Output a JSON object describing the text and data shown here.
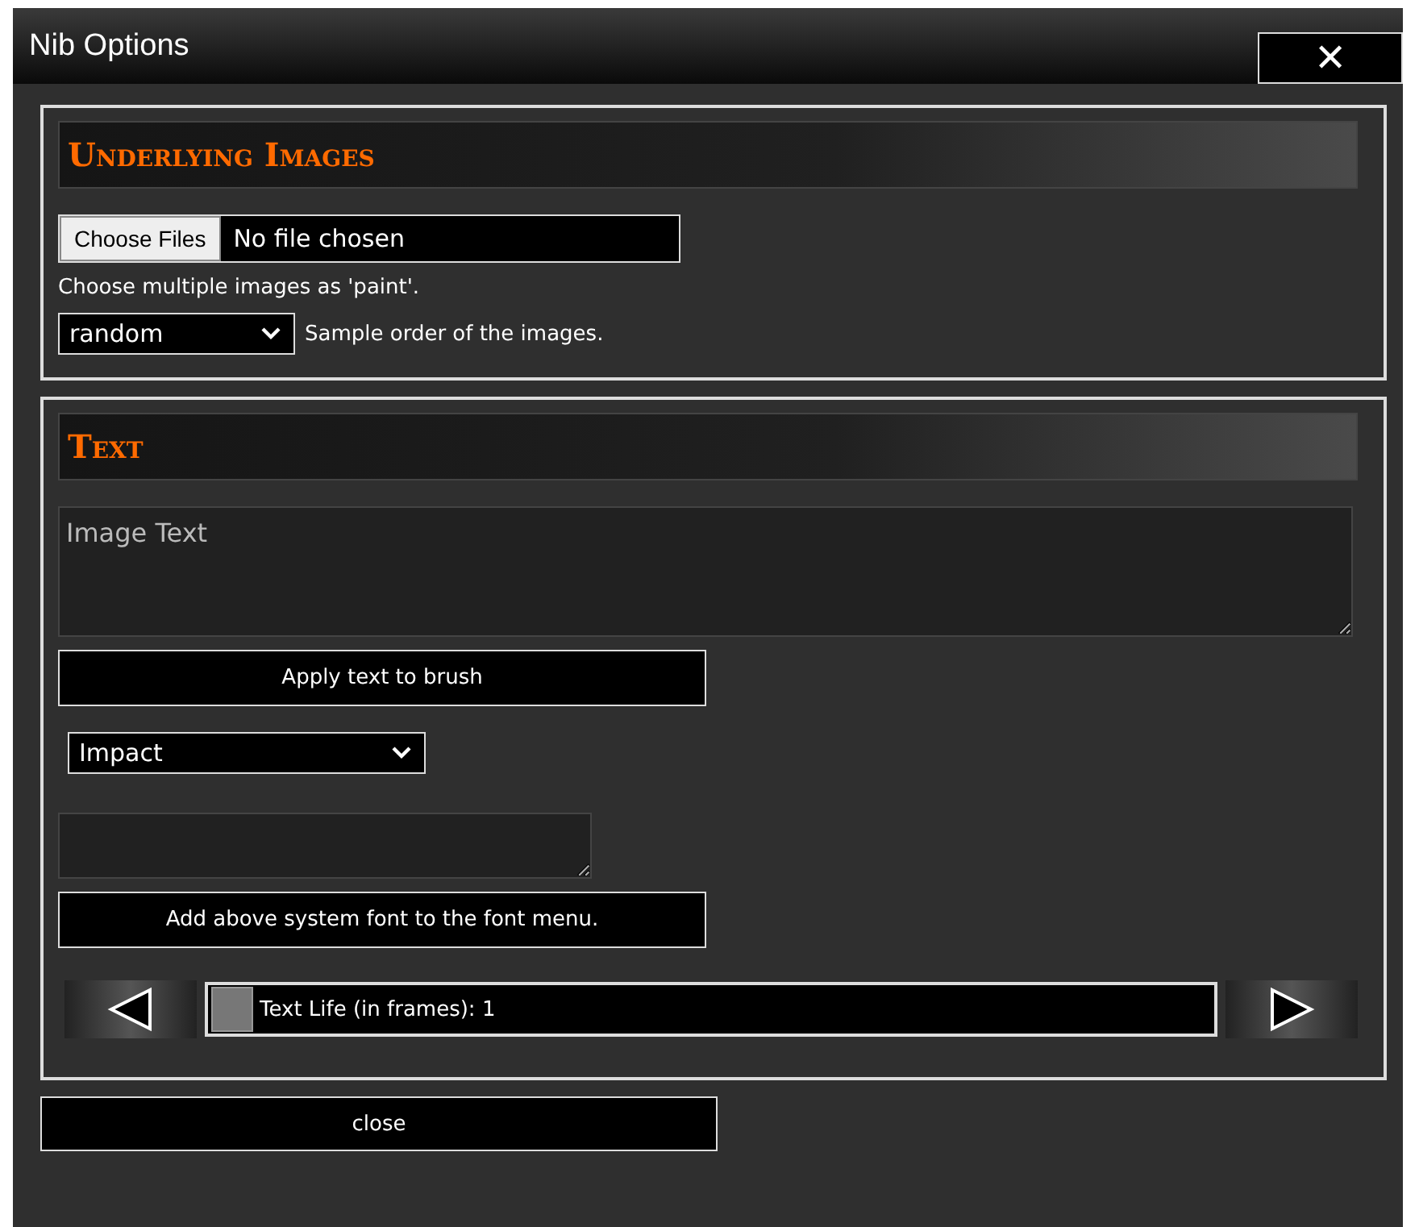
{
  "window": {
    "title": "Nib Options",
    "close_glyph": "✕"
  },
  "sections": [
    {
      "heading": "Underlying Images",
      "items": [
        {
          "kind": "file",
          "button": "Choose Files",
          "value": "No file chosen"
        },
        {
          "kind": "note",
          "text": "Choose multiple images as 'paint'."
        },
        {
          "kind": "select",
          "value": "random",
          "label": "Sample order of the images."
        }
      ]
    },
    {
      "heading": "Text",
      "items": [
        {
          "kind": "textarea",
          "placeholder": "Image Text"
        },
        {
          "kind": "button",
          "label": "Apply text to brush"
        },
        {
          "kind": "select",
          "value": "Impact"
        },
        {
          "kind": "small-textarea"
        },
        {
          "kind": "button",
          "label": "Add above system font to the font menu."
        },
        {
          "kind": "slider",
          "label": "Text Life (in frames): 1",
          "level": 0
        }
      ]
    }
  ],
  "footer_button": "close"
}
